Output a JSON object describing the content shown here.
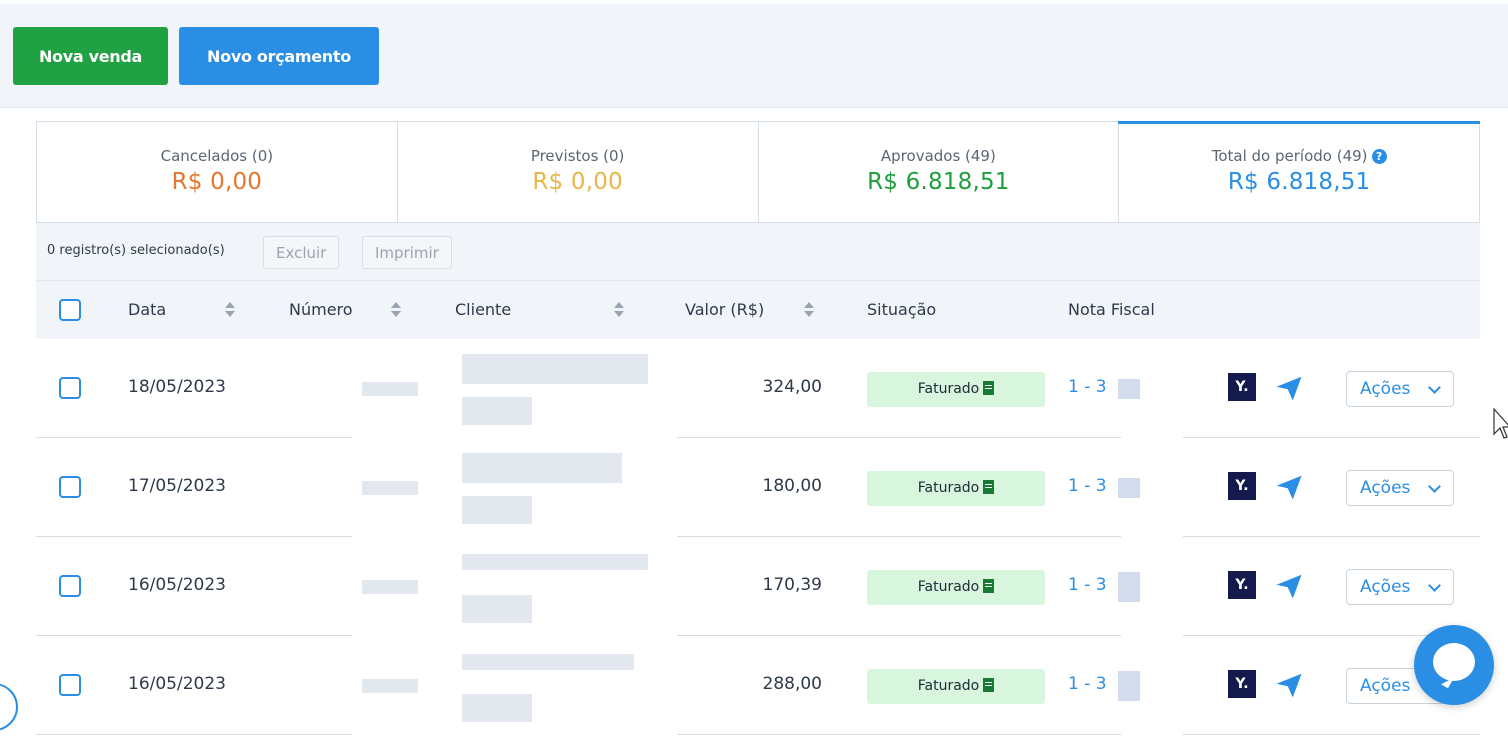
{
  "toolbar": {
    "nova_venda": "Nova venda",
    "novo_orcamento": "Novo orçamento"
  },
  "summary": [
    {
      "label": "Cancelados (0)",
      "value": "R$ 0,00",
      "color": "#e5762d"
    },
    {
      "label": "Previstos (0)",
      "value": "R$ 0,00",
      "color": "#e8b64a"
    },
    {
      "label": "Aprovados (49)",
      "value": "R$ 6.818,51",
      "color": "#1f9e3d"
    },
    {
      "label": "Total do período (49)",
      "value": "R$ 6.818,51",
      "color": "#2a8ee5",
      "help_icon": "question-circle-icon"
    }
  ],
  "selection": {
    "count_text": "0 registro(s) selecionado(s)",
    "excluir": "Excluir",
    "imprimir": "Imprimir"
  },
  "table": {
    "headers": {
      "data": "Data",
      "numero": "Número",
      "cliente": "Cliente",
      "valor": "Valor (R$)",
      "situacao": "Situação",
      "nota_fiscal": "Nota Fiscal"
    },
    "rows": [
      {
        "date": "18/05/2023",
        "valor": "324,00",
        "situacao": "Faturado",
        "nf": "1 - 3",
        "acoes": "Ações"
      },
      {
        "date": "17/05/2023",
        "valor": "180,00",
        "situacao": "Faturado",
        "nf": "1 - 3",
        "acoes": "Ações"
      },
      {
        "date": "16/05/2023",
        "valor": "170,39",
        "situacao": "Faturado",
        "nf": "1 - 3",
        "acoes": "Ações"
      },
      {
        "date": "16/05/2023",
        "valor": "288,00",
        "situacao": "Faturado",
        "nf": "1 - 3",
        "acoes": "Ações"
      }
    ]
  },
  "icons": {
    "sort": "sort-icon",
    "doc": "document-icon",
    "y": "y-app-icon",
    "send": "paper-plane-icon",
    "chevron": "chevron-down-icon",
    "chat": "chat-icon"
  }
}
